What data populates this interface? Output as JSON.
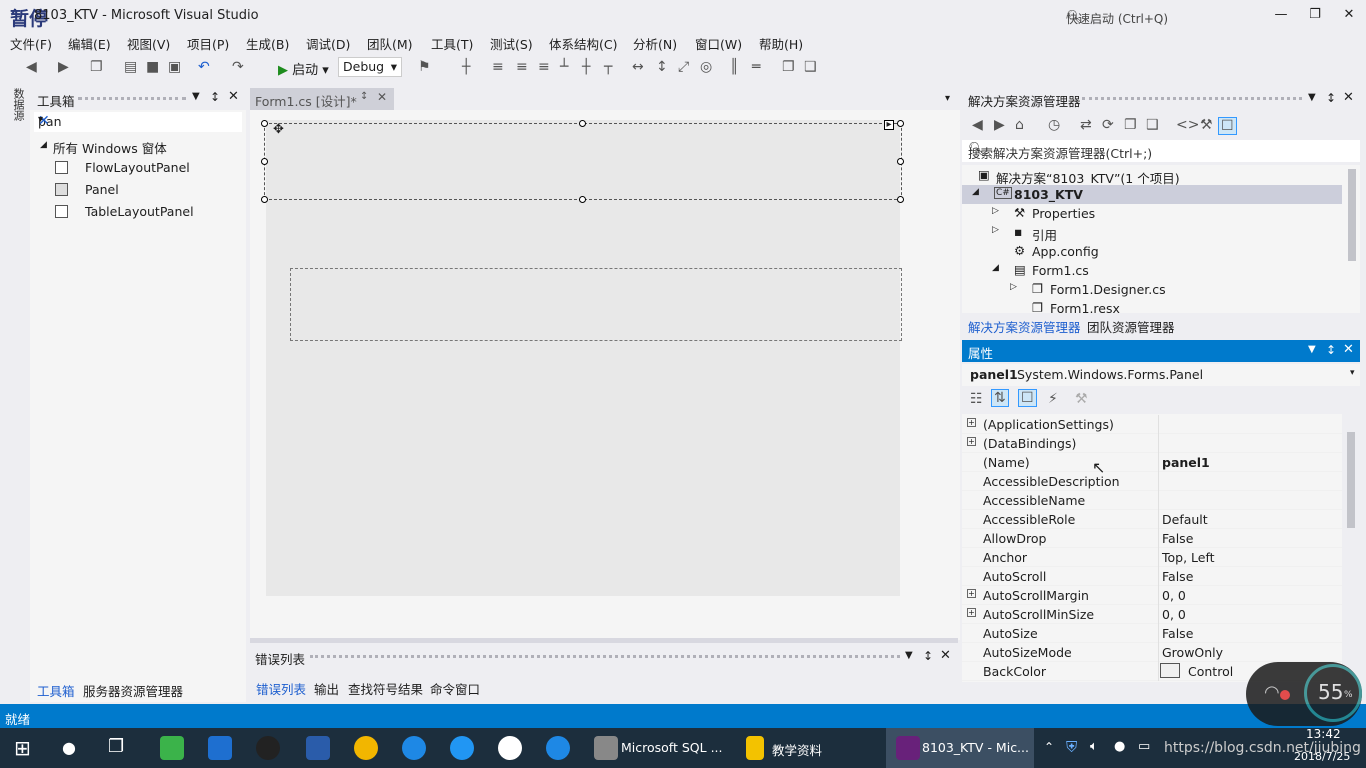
{
  "window": {
    "title": "8103_KTV - Microsoft Visual Studio",
    "paused_label": "暂停",
    "quick_launch": "快速启动 (Ctrl+Q)"
  },
  "menu": [
    "文件(F)",
    "编辑(E)",
    "视图(V)",
    "项目(P)",
    "生成(B)",
    "调试(D)",
    "团队(M)",
    "工具(T)",
    "测试(S)",
    "体系结构(C)",
    "分析(N)",
    "窗口(W)",
    "帮助(H)"
  ],
  "toolbar": {
    "start_label": "启动",
    "config": "Debug"
  },
  "left_strip": {
    "label": "数据源"
  },
  "toolbox": {
    "title": "工具箱",
    "search_value": "pan",
    "group": "所有 Windows 窗体",
    "items": [
      "FlowLayoutPanel",
      "Panel",
      "TableLayoutPanel"
    ],
    "footer_tabs": [
      "工具箱",
      "服务器资源管理器"
    ]
  },
  "designer": {
    "tab_label": "Form1.cs [设计]*"
  },
  "error_list": {
    "title": "错误列表",
    "footer_tabs": [
      "错误列表",
      "输出",
      "查找符号结果",
      "命令窗口"
    ]
  },
  "solution_explorer": {
    "title": "解决方案资源管理器",
    "search_placeholder": "搜索解决方案资源管理器(Ctrl+;)",
    "tree": [
      "解决方案“8103_KTV”(1 个项目)",
      "8103_KTV",
      "Properties",
      "引用",
      "App.config",
      "Form1.cs",
      "Form1.Designer.cs",
      "Form1.resx"
    ],
    "tabs": [
      "解决方案资源管理器",
      "团队资源管理器"
    ]
  },
  "properties": {
    "title": "属性",
    "object_name": "panel1",
    "object_type": "System.Windows.Forms.Panel",
    "rows": [
      {
        "name": "(ApplicationSettings)",
        "value": "",
        "expandable": true
      },
      {
        "name": "(DataBindings)",
        "value": "",
        "expandable": true
      },
      {
        "name": "(Name)",
        "value": "panel1",
        "expandable": false
      },
      {
        "name": "AccessibleDescription",
        "value": "",
        "expandable": false
      },
      {
        "name": "AccessibleName",
        "value": "",
        "expandable": false
      },
      {
        "name": "AccessibleRole",
        "value": "Default",
        "expandable": false
      },
      {
        "name": "AllowDrop",
        "value": "False",
        "expandable": false
      },
      {
        "name": "Anchor",
        "value": "Top, Left",
        "expandable": false
      },
      {
        "name": "AutoScroll",
        "value": "False",
        "expandable": false
      },
      {
        "name": "AutoScrollMargin",
        "value": "0, 0",
        "expandable": true
      },
      {
        "name": "AutoScrollMinSize",
        "value": "0, 0",
        "expandable": true
      },
      {
        "name": "AutoSize",
        "value": "False",
        "expandable": false
      },
      {
        "name": "AutoSizeMode",
        "value": "GrowOnly",
        "expandable": false
      },
      {
        "name": "BackColor",
        "value": "Control",
        "expandable": false
      }
    ]
  },
  "status": {
    "text": "就绪"
  },
  "network_widget": {
    "percent": "55",
    "unit": "%"
  },
  "taskbar": {
    "tasks": [
      "Microsoft SQL ...",
      "教学资料",
      "8103_KTV - Mic..."
    ],
    "clock_time": "13:42",
    "clock_date": "2018/7/25",
    "watermark": "https://blog.csdn.net/jiubing"
  },
  "colors": {
    "accent": "#007acc",
    "taskbar": "#1c2e3d",
    "chrome": "#eeeef2"
  }
}
